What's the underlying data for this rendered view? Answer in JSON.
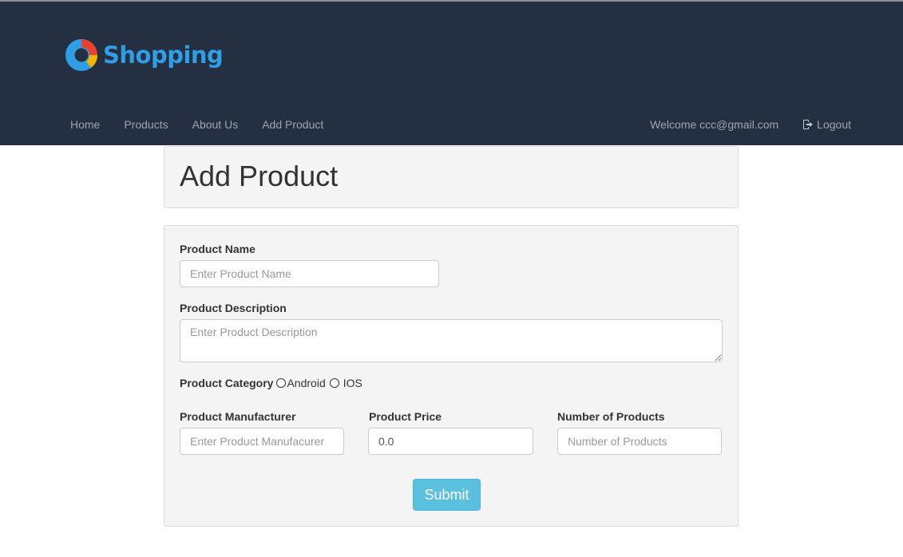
{
  "brand": {
    "name": "Shopping",
    "logo_icon": "shopping-logo-icon",
    "text_color": "#2f9ee6"
  },
  "navbar": {
    "background": "#243041",
    "items": [
      {
        "label": "Home"
      },
      {
        "label": "Products"
      },
      {
        "label": "About Us"
      },
      {
        "label": "Add Product"
      }
    ],
    "welcome": "Welcome ccc@gmail.com",
    "logout_label": "Logout",
    "logout_icon": "logout-icon"
  },
  "page": {
    "title": "Add Product"
  },
  "form": {
    "product_name": {
      "label": "Product Name",
      "placeholder": "Enter Product Name",
      "value": ""
    },
    "product_description": {
      "label": "Product Description",
      "placeholder": "Enter Product Description",
      "value": ""
    },
    "product_category": {
      "label": "Product Category",
      "options": [
        {
          "label": "Android",
          "selected": false
        },
        {
          "label": "IOS",
          "selected": false
        }
      ]
    },
    "product_manufacturer": {
      "label": "Product Manufacturer",
      "placeholder": "Enter Product Manufacurer",
      "value": ""
    },
    "product_price": {
      "label": "Product Price",
      "placeholder": "",
      "value": "0.0"
    },
    "number_of_products": {
      "label": "Number of Products",
      "placeholder": "Number of Products",
      "value": ""
    },
    "submit_label": "Submit",
    "submit_color": "#5bc0de"
  }
}
